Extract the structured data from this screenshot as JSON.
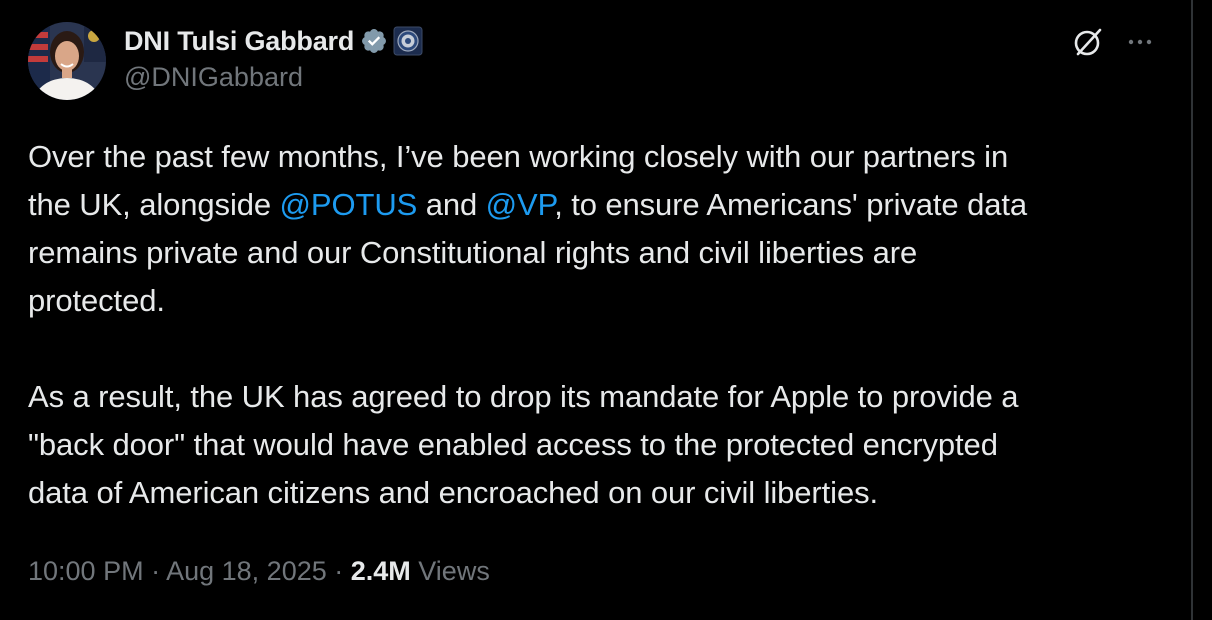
{
  "author": {
    "display_name": "DNI Tulsi Gabbard",
    "handle": "@DNIGabbard",
    "verified_color": "#829aab"
  },
  "header_actions": {
    "grok_icon": "grok-icon",
    "more_icon": "more-icon"
  },
  "tweet": {
    "line1": "Over the past few months, I’ve been working closely with our partners in",
    "line2_prefix": "the UK, alongside ",
    "mention_potus": "@POTUS",
    "line2_and": " and ",
    "mention_vp": "@VP",
    "line2_suffix": ", to ensure Americans' private data",
    "line3": "remains private and our Constitutional rights and civil liberties are",
    "line4": "protected.",
    "line5": "As a result, the UK has agreed to drop its mandate for Apple to provide a",
    "line6": "\"back door\" that would have enabled access to the protected encrypted",
    "line7": "data of American citizens and encroached on our civil liberties."
  },
  "meta": {
    "time": "10:00 PM",
    "sep1": " · ",
    "date": "Aug 18, 2025",
    "sep2": " · ",
    "views_count": "2.4M",
    "views_label": " Views"
  },
  "colors": {
    "background": "#000000",
    "text": "#e7e9ea",
    "secondary": "#71767b",
    "link": "#1d9bf0"
  }
}
